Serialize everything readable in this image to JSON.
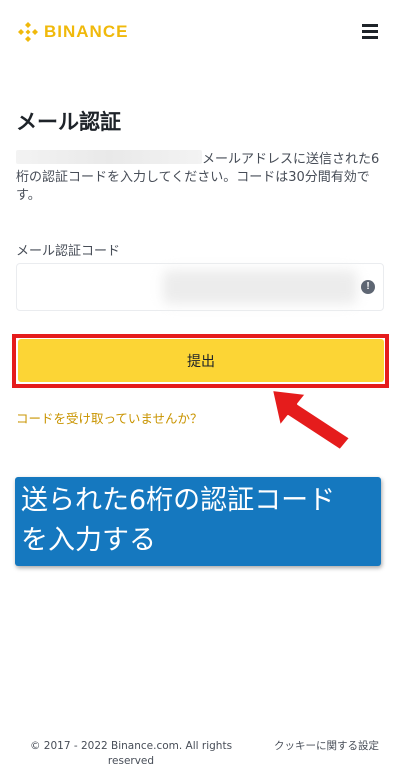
{
  "header": {
    "brand": "BINANCE",
    "brand_color": "#f0b90b",
    "menu_icon": "hamburger-menu-icon"
  },
  "page": {
    "title": "メール認証",
    "description_rest": "メールアドレスに送信された6桁の認証コードを入力してください。コードは30分間有効です。"
  },
  "form": {
    "field_label": "メール認証コード",
    "code_value": "",
    "info_icon": "info-icon",
    "info_glyph": "!",
    "submit_label": "提出",
    "submit_color": "#fcd535",
    "resend_link": "コードを受け取っていませんか？"
  },
  "annotation": {
    "callout_line1": "送られた6桁の認証コード",
    "callout_line2": "を入力する",
    "callout_color": "#1578bf",
    "highlight_color": "#e51c1c"
  },
  "footer": {
    "copyright": "© 2017 - 2022 Binance.com. All rights reserved",
    "cookie_settings": "クッキーに関する設定"
  }
}
